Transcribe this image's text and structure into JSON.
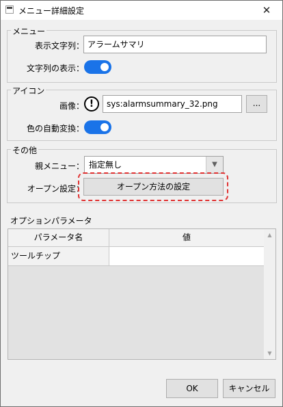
{
  "window": {
    "title": "メニュー詳細設定",
    "close_glyph": "✕"
  },
  "menu_group": {
    "legend": "メニュー",
    "display_text_label": "表示文字列：",
    "display_text_value": "アラームサマリ",
    "show_text_label": "文字列の表示：",
    "show_text_on": true
  },
  "icon_group": {
    "legend": "アイコン",
    "image_label": "画像：",
    "warning_glyph": "!",
    "image_value": "sys:alarmsummary_32.png",
    "browse_label": "...",
    "auto_color_label": "色の自動変換：",
    "auto_color_on": true
  },
  "other_group": {
    "legend": "その他",
    "parent_menu_label": "親メニュー：",
    "parent_menu_value": "指定無し",
    "dropdown_arrow": "▼",
    "open_setting_label": "オープン設定：",
    "open_method_button": "オープン方法の設定"
  },
  "options": {
    "title": "オプションパラメータ",
    "columns": [
      "パラメータ名",
      "値"
    ],
    "rows": [
      {
        "name": "ツールチップ",
        "value": ""
      }
    ],
    "scroll_up": "▲",
    "scroll_down": "▼"
  },
  "footer": {
    "ok_label": "OK",
    "cancel_label": "キャンセル"
  },
  "colors": {
    "toggle_on": "#1a73e8",
    "highlight": "#e03030"
  }
}
